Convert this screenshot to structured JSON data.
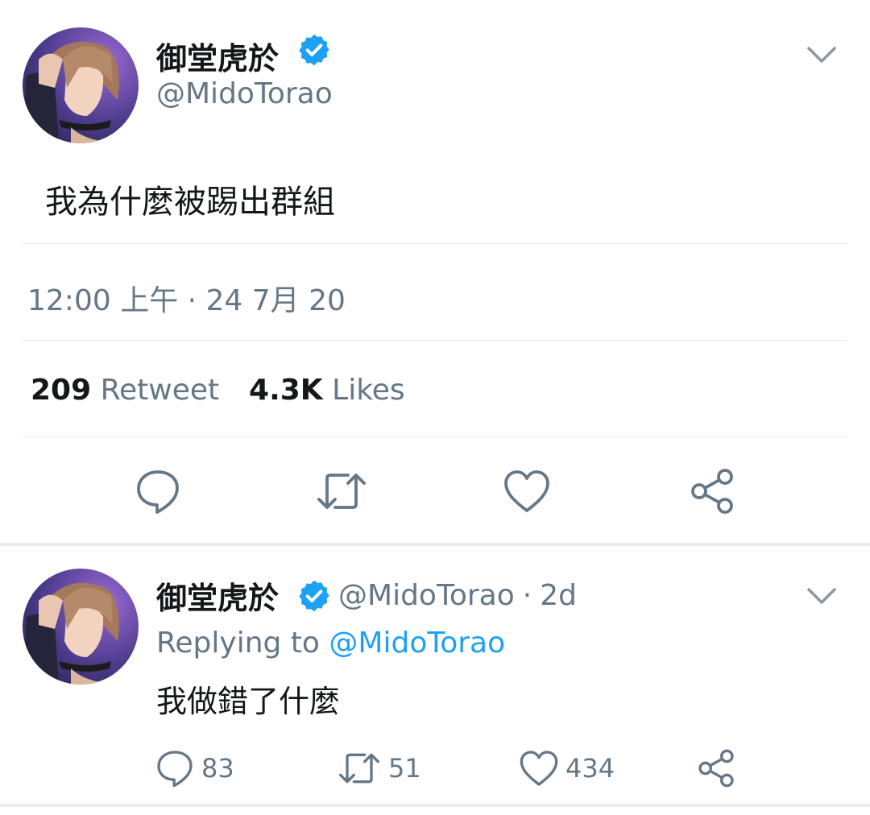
{
  "colors": {
    "text": "#14171a",
    "secondary": "#657786",
    "verified": "#1da1f2",
    "link": "#1da1f2",
    "divider": "#e1e8ed",
    "icon": "#657786"
  },
  "main_tweet": {
    "display_name": "御堂虎於",
    "handle": "@MidoTorao",
    "verified_icon": "verified-badge-icon",
    "menu_icon": "chevron-down-icon",
    "text": "我為什麼被踢出群組",
    "timestamp": "12:00 上午 · 24 7月 20",
    "stats": {
      "retweets_count": "209",
      "retweets_label": "Retweet",
      "likes_count": "4.3K",
      "likes_label": "Likes"
    },
    "actions": [
      "reply-icon",
      "retweet-icon",
      "like-icon",
      "share-icon"
    ]
  },
  "reply_tweet": {
    "display_name": "御堂虎於",
    "handle": "@MidoTorao",
    "separator": "·",
    "age": "2d",
    "replying_prefix": "Replying to",
    "replying_handle": "@MidoTorao",
    "text": "我做錯了什麼",
    "counts": {
      "replies": "83",
      "retweets": "51",
      "likes": "434"
    }
  }
}
